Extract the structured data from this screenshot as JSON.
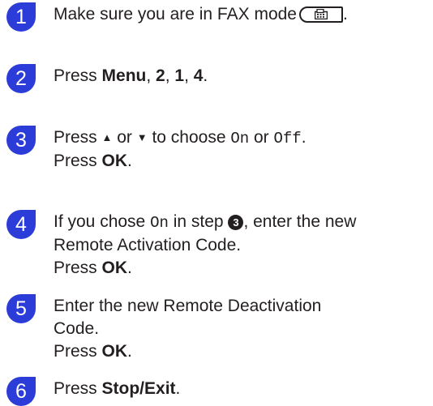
{
  "steps": [
    {
      "number": "1",
      "text_1": "Make sure you are in FAX mode",
      "icon": "fax-mode-key-icon",
      "text_2": "."
    },
    {
      "number": "2",
      "t1": "Press ",
      "menu": "Menu",
      "sep1": ", ",
      "k1": "2",
      "sep2": ", ",
      "k2": "1",
      "sep3": ", ",
      "k3": "4",
      "end": "."
    },
    {
      "number": "3",
      "t1": "Press ",
      "up": "▲",
      "or1": " or ",
      "down": "▼",
      "t2": " to choose ",
      "opt_on": "On",
      "or2": " or ",
      "opt_off": "Off",
      "end": ".",
      "press": "Press ",
      "ok": "OK",
      "dot": "."
    },
    {
      "number": "4",
      "t1": "If you chose ",
      "opt_on": "On",
      "t2": " in step ",
      "ref": "3",
      "t3": ", enter the new",
      "line2": "Remote Activation Code.",
      "press": "Press ",
      "ok": "OK",
      "dot": "."
    },
    {
      "number": "5",
      "line1": "Enter the new Remote Deactivation",
      "line2": "Code.",
      "press": "Press ",
      "ok": "OK",
      "dot": "."
    },
    {
      "number": "6",
      "press": "Press ",
      "key": "Stop/Exit",
      "dot": "."
    }
  ]
}
